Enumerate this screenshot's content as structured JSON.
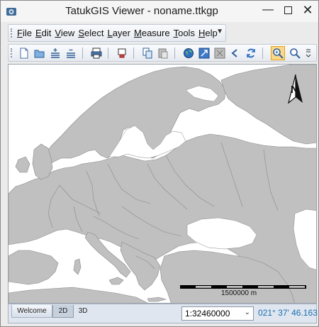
{
  "window": {
    "title": "TatukGIS Viewer - noname.ttkgp"
  },
  "menubar": {
    "items": [
      "File",
      "Edit",
      "View",
      "Select",
      "Layer",
      "Measure",
      "Tools",
      "Help"
    ]
  },
  "toolbar": {
    "buttons": [
      {
        "name": "new-icon"
      },
      {
        "name": "open-icon"
      },
      {
        "name": "add-layer-icon"
      },
      {
        "name": "remove-layer-icon"
      },
      {
        "name": "print-icon"
      },
      {
        "name": "export-icon"
      },
      {
        "name": "copy-icon"
      },
      {
        "name": "paste-icon"
      },
      {
        "name": "globe-icon"
      },
      {
        "name": "full-extent-icon"
      },
      {
        "name": "zoom-layer-icon"
      },
      {
        "name": "back-icon"
      },
      {
        "name": "refresh-icon"
      },
      {
        "name": "zoom-select-icon"
      },
      {
        "name": "zoom-icon"
      }
    ],
    "active_button": "zoom-select-icon"
  },
  "map": {
    "land_color": "#c0c0c0",
    "water_color": "#ffffff",
    "border_color": "#7a7a7a",
    "north_label": "N",
    "scale_label": "1500000 m"
  },
  "statusbar": {
    "tabs": [
      "Welcome",
      "2D",
      "3D"
    ],
    "active_tab": "2D",
    "scale_value": "1:32460000",
    "coordinate": "021° 37' 46.163"
  }
}
